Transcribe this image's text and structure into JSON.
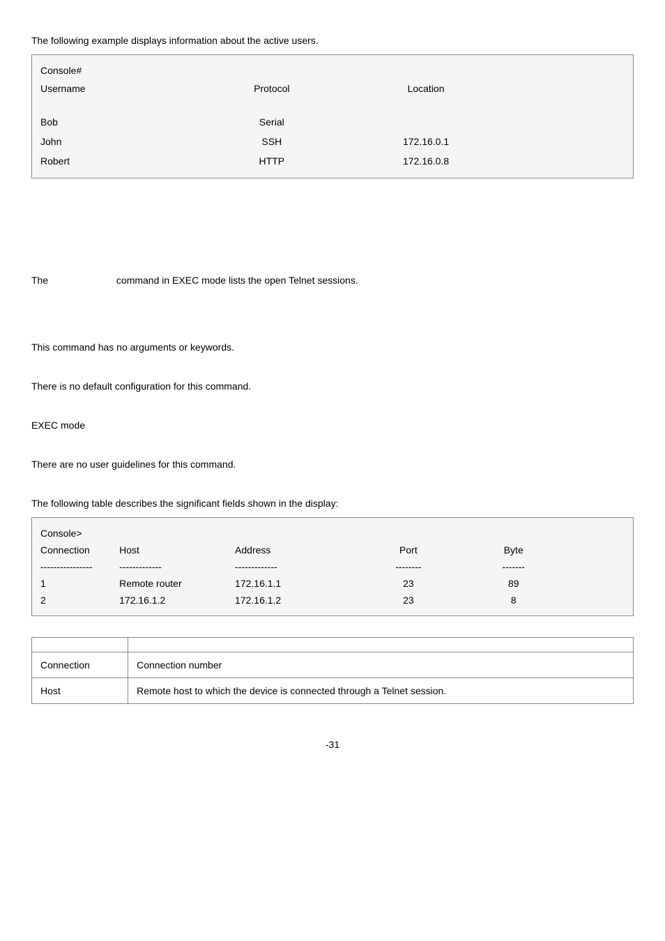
{
  "intro1": "The following example displays information about the active users.",
  "console1": {
    "prompt": "Console#",
    "headers": {
      "username": "Username",
      "protocol": "Protocol",
      "location": "Location"
    },
    "rows": [
      {
        "username": "Bob",
        "protocol": "Serial",
        "location": ""
      },
      {
        "username": "John",
        "protocol": "SSH",
        "location": "172.16.0.1"
      },
      {
        "username": "Robert",
        "protocol": "HTTP",
        "location": "172.16.0.8"
      }
    ]
  },
  "desc": {
    "the": "The",
    "rest": "command in EXEC mode lists the open Telnet sessions."
  },
  "syntax_body": "This command has no arguments or keywords.",
  "default_body": "There is no default configuration for this command.",
  "mode_body": "EXEC mode",
  "guidelines_body": "There are no user guidelines for this command.",
  "intro2": "The following table describes the significant fields shown in the display:",
  "console2": {
    "prompt": "Console>",
    "headers": {
      "connection": "Connection",
      "host": "Host",
      "address": "Address",
      "port": "Port",
      "byte": "Byte"
    },
    "sep": {
      "a": "----------------",
      "b": "-------------",
      "c": "-------------",
      "d": "--------",
      "e": "-------"
    },
    "rows": [
      {
        "connection": "1",
        "host": "Remote router",
        "address": "172.16.1.1",
        "port": "23",
        "byte": "89"
      },
      {
        "connection": "2",
        "host": "172.16.1.2",
        "address": "172.16.1.2",
        "port": "23",
        "byte": "8"
      }
    ]
  },
  "fields_table": {
    "header_empty": "",
    "rows": [
      {
        "field": "Connection",
        "desc": "Connection number"
      },
      {
        "field": "Host",
        "desc": "Remote host to which the device is connected through a Telnet session."
      }
    ]
  },
  "page_number": "-31"
}
